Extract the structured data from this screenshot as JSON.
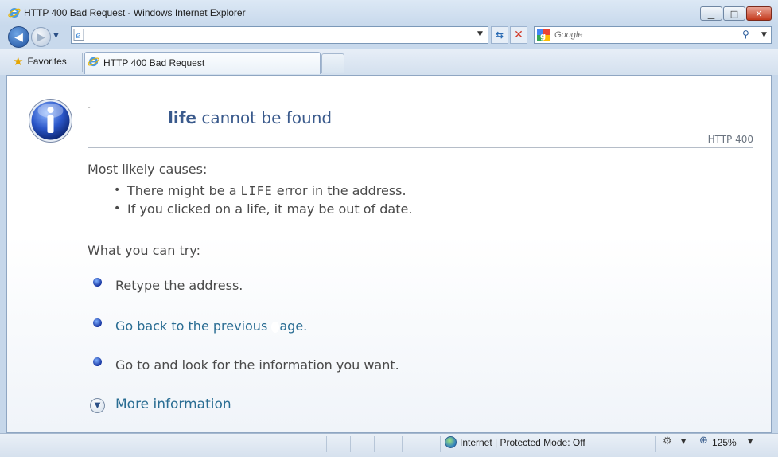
{
  "window": {
    "title": "HTTP 400 Bad Request - Windows Internet Explorer",
    "minimize_glyph": "▁",
    "maximize_glyph": "□",
    "close_glyph": "✕"
  },
  "navbar": {
    "back_glyph": "◀",
    "forward_glyph": "▶",
    "recent_glyph": "▼",
    "address_value": "",
    "address_dropdown_glyph": "▼",
    "refresh_glyph": "⇆",
    "stop_glyph": "✕",
    "search_placeholder": "Google",
    "search_go_glyph": "⚲",
    "search_dropdown_glyph": "▼"
  },
  "favorites": {
    "label": "Favorites",
    "star_glyph": "★"
  },
  "tabs": [
    {
      "label": "HTTP 400 Bad Request"
    }
  ],
  "page": {
    "heading_dash": "-",
    "heading_life": "life",
    "heading_rest": " cannot be found",
    "http_code": "HTTP 400",
    "causes_title": "Most likely causes:",
    "causes": [
      {
        "before": "There might be a ",
        "word": "LIFE",
        "after": " error in the address."
      },
      {
        "text": "If you clicked on a life, it may be out of date."
      }
    ],
    "try_title": "What you can try:",
    "actions": [
      {
        "text": "Retype the address."
      },
      {
        "before": "Go back to the previous ",
        "after": "age."
      },
      {
        "text": "Go to  and look for the information you want."
      }
    ],
    "more_info": "More information",
    "more_glyph": "▼"
  },
  "statusbar": {
    "zone": "Internet | Protected Mode: Off",
    "security_glyph": "⚙",
    "dropdown_glyph": "▼",
    "zoom_glyph": "⊕",
    "zoom": "125%"
  },
  "icons": {
    "ie_logo": "ie-logo-icon",
    "google": "google-icon",
    "info": "info-icon",
    "globe": "globe-icon"
  },
  "colors": {
    "heading": "#3a5a8c",
    "link": "#2a6d93",
    "body_text": "#4a4a4a"
  }
}
